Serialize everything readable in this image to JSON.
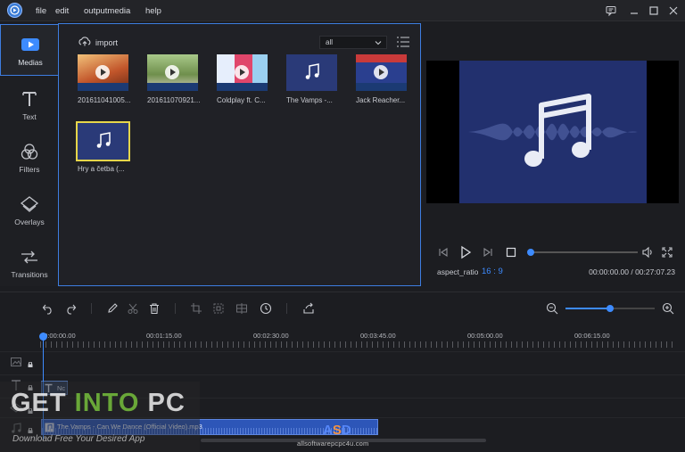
{
  "menu": {
    "file": "file",
    "edit": "edit",
    "output": "outputmedia",
    "help": "help"
  },
  "rail": {
    "medias": "Medias",
    "text": "Text",
    "filters": "Filters",
    "overlays": "Overlays",
    "transitions": "Transitions"
  },
  "media": {
    "import_label": "import",
    "filter_value": "all",
    "items": [
      {
        "caption": "201611041005...",
        "kind": "video"
      },
      {
        "caption": "201611070921...",
        "kind": "video"
      },
      {
        "caption": "Coldplay ft. C...",
        "kind": "video"
      },
      {
        "caption": "The Vamps -...",
        "kind": "audio"
      },
      {
        "caption": "Jack Reacher...",
        "kind": "video"
      },
      {
        "caption": "Hry a četba (...",
        "kind": "audio"
      }
    ]
  },
  "player": {
    "aspect_label": "aspect_ratio",
    "aspect_value": "16 : 9",
    "time": "00:00:00.00 / 00:27:07.23",
    "progress": 0.0
  },
  "timeline": {
    "ticks": [
      "00:00:00.00",
      "00:01:15.00",
      "00:02:30.00",
      "00:03:45.00",
      "00:05:00.00",
      "00:06:15.00"
    ],
    "text_clip_label": "Nc",
    "audio_clip_label": "The Vamps - Can We Dance (Official Video).mp3",
    "zoom_level": 0.5
  },
  "watermark": {
    "title_a": "GET ",
    "title_b": "INTO",
    "title_c": " PC",
    "subtitle": "Download Free Your Desired App",
    "site": "allsoftwarepcpc4u.com",
    "logo_a": "A",
    "logo_b": "S",
    "logo_c": "D"
  },
  "colors": {
    "accent": "#3d7de0",
    "selected": "#e6d64a",
    "preview_bg": "#22306e"
  }
}
